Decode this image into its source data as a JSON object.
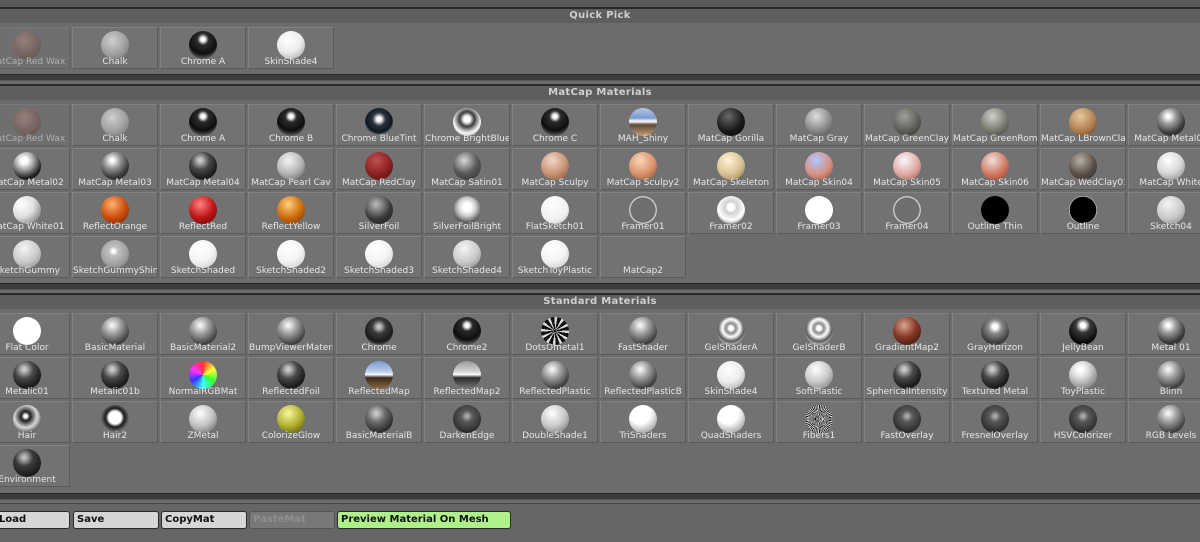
{
  "sections": {
    "quick_pick": "Quick Pick",
    "matcap": "MatCap Materials",
    "standard": "Standard Materials"
  },
  "quick_pick": [
    {
      "label": "MatCap Red Wax",
      "style": "red-wax",
      "dim": true
    },
    {
      "label": "Chalk",
      "style": "chalk"
    },
    {
      "label": "Chrome A",
      "style": "chrome"
    },
    {
      "label": "SkinShade4",
      "style": "skin-white"
    }
  ],
  "matcap": [
    {
      "label": "MatCap Red Wax",
      "style": "red-wax",
      "dim": true
    },
    {
      "label": "Chalk",
      "style": "chalk"
    },
    {
      "label": "Chrome A",
      "style": "chrome"
    },
    {
      "label": "Chrome B",
      "style": "chrome"
    },
    {
      "label": "Chrome BlueTint",
      "style": "chrome-blue"
    },
    {
      "label": "Chrome BrightBlue",
      "style": "chrome-bright"
    },
    {
      "label": "Chrome C",
      "style": "chrome"
    },
    {
      "label": "MAH_Shiny",
      "style": "shiny-env"
    },
    {
      "label": "MatCap Gorilla",
      "style": "gorilla"
    },
    {
      "label": "MatCap Gray",
      "style": "gray"
    },
    {
      "label": "MatCap GreenClay",
      "style": "greenclay"
    },
    {
      "label": "MatCap GreenRom",
      "style": "greenrom"
    },
    {
      "label": "MatCap LBrownCla",
      "style": "brownclay"
    },
    {
      "label": "MatCap Metal01",
      "style": "metal"
    },
    {
      "label": "MatCap Metal02",
      "style": "metal-bright"
    },
    {
      "label": "MatCap Metal03",
      "style": "metal"
    },
    {
      "label": "MatCap Metal04",
      "style": "metal-dark"
    },
    {
      "label": "MatCap Pearl Cav",
      "style": "pearl"
    },
    {
      "label": "MatCap RedClay",
      "style": "redclay"
    },
    {
      "label": "MatCap Satin01",
      "style": "satin"
    },
    {
      "label": "MatCap Sculpy",
      "style": "sculpy"
    },
    {
      "label": "MatCap Sculpy2",
      "style": "sculpy2"
    },
    {
      "label": "MatCap Skeleton",
      "style": "skeleton"
    },
    {
      "label": "MatCap Skin04",
      "style": "skin04"
    },
    {
      "label": "MatCap Skin05",
      "style": "skin05"
    },
    {
      "label": "MatCap Skin06",
      "style": "skin06"
    },
    {
      "label": "MatCap WedClay01",
      "style": "wedclay"
    },
    {
      "label": "MatCap White",
      "style": "white"
    },
    {
      "label": "MatCap White01",
      "style": "white01"
    },
    {
      "label": "ReflectOrange",
      "style": "orange"
    },
    {
      "label": "ReflectRed",
      "style": "red"
    },
    {
      "label": "ReflectYellow",
      "style": "yellow-orange"
    },
    {
      "label": "SilverFoil",
      "style": "silverfoil"
    },
    {
      "label": "SilverFoilBright",
      "style": "silverbright"
    },
    {
      "label": "FlatSketch01",
      "style": "flatsketch"
    },
    {
      "label": "Framer01",
      "style": "framer"
    },
    {
      "label": "Framer02",
      "style": "framer-white"
    },
    {
      "label": "Framer03",
      "style": "framer-solid"
    },
    {
      "label": "Framer04",
      "style": "framer"
    },
    {
      "label": "Outline Thin",
      "style": "black"
    },
    {
      "label": "Outline",
      "style": "outline"
    },
    {
      "label": "Sketch04",
      "style": "sketch"
    },
    {
      "label": "SketchGummy",
      "style": "sketch"
    },
    {
      "label": "SketchGummyShine",
      "style": "sketchshine"
    },
    {
      "label": "SketchShaded",
      "style": "sketchshaded"
    },
    {
      "label": "SketchShaded2",
      "style": "sketchshaded"
    },
    {
      "label": "SketchShaded3",
      "style": "sketchshaded"
    },
    {
      "label": "SketchShaded4",
      "style": "sketch"
    },
    {
      "label": "SketchToyPlastic",
      "style": "sketchshaded"
    },
    {
      "label": "MatCap2",
      "style": "none"
    }
  ],
  "standard": [
    {
      "label": "Flat Color",
      "style": "flat"
    },
    {
      "label": "BasicMaterial",
      "style": "basic"
    },
    {
      "label": "BasicMaterial2",
      "style": "basic"
    },
    {
      "label": "BumpViewerMaterial",
      "style": "basic"
    },
    {
      "label": "Chrome",
      "style": "chrome-dull"
    },
    {
      "label": "Chrome2",
      "style": "chrome"
    },
    {
      "label": "DotsOmetal1",
      "style": "dots"
    },
    {
      "label": "FastShader",
      "style": "basic"
    },
    {
      "label": "GelShaderA",
      "style": "gel"
    },
    {
      "label": "GelShaderB",
      "style": "gel"
    },
    {
      "label": "GradientMap2",
      "style": "gradientmap"
    },
    {
      "label": "GrayHorizon",
      "style": "horizon"
    },
    {
      "label": "JellyBean",
      "style": "jelly"
    },
    {
      "label": "Metal 01",
      "style": "metal"
    },
    {
      "label": "Metalic01",
      "style": "metal-dark"
    },
    {
      "label": "Metalic01b",
      "style": "metal-dark"
    },
    {
      "label": "NormalRGBMat",
      "style": "rgb"
    },
    {
      "label": "ReflectedFoil",
      "style": "metal-dark"
    },
    {
      "label": "ReflectedMap",
      "style": "reflectmap"
    },
    {
      "label": "ReflectedMap2",
      "style": "reflectmap2"
    },
    {
      "label": "ReflectedPlastic",
      "style": "basic"
    },
    {
      "label": "ReflectedPlasticB",
      "style": "basic"
    },
    {
      "label": "SkinShade4",
      "style": "skin-white"
    },
    {
      "label": "SoftPlastic",
      "style": "soft"
    },
    {
      "label": "SphericalIntensity",
      "style": "metal-dark"
    },
    {
      "label": "Textured Metal",
      "style": "metal-dark"
    },
    {
      "label": "ToyPlastic",
      "style": "toy"
    },
    {
      "label": "Blinn",
      "style": "basic"
    },
    {
      "label": "Hair",
      "style": "hair"
    },
    {
      "label": "Hair2",
      "style": "hair2"
    },
    {
      "label": "ZMetal",
      "style": "zmetal"
    },
    {
      "label": "ColorizeGlow",
      "style": "glow"
    },
    {
      "label": "BasicMaterialB",
      "style": "basic-dark"
    },
    {
      "label": "DarkenEdge",
      "style": "darkedge"
    },
    {
      "label": "DoubleShade1",
      "style": "soft"
    },
    {
      "label": "TriShaders",
      "style": "tri"
    },
    {
      "label": "QuadShaders",
      "style": "tri"
    },
    {
      "label": "Fibers1",
      "style": "fibers"
    },
    {
      "label": "FastOverlay",
      "style": "darkedge"
    },
    {
      "label": "FresnelOverlay",
      "style": "darkedge"
    },
    {
      "label": "HSVColorizer",
      "style": "darkedge"
    },
    {
      "label": "RGB Levels",
      "style": "basic"
    },
    {
      "label": "Environment",
      "style": "env-dark"
    }
  ],
  "buttons": {
    "load": "Load",
    "save": "Save",
    "copy": "CopyMat",
    "paste": "PasteMat",
    "preview": "Preview Material On Mesh"
  },
  "colors": {
    "panel": "#6c6c6c",
    "tile": "#727272",
    "preview_green": "#aef08a"
  }
}
